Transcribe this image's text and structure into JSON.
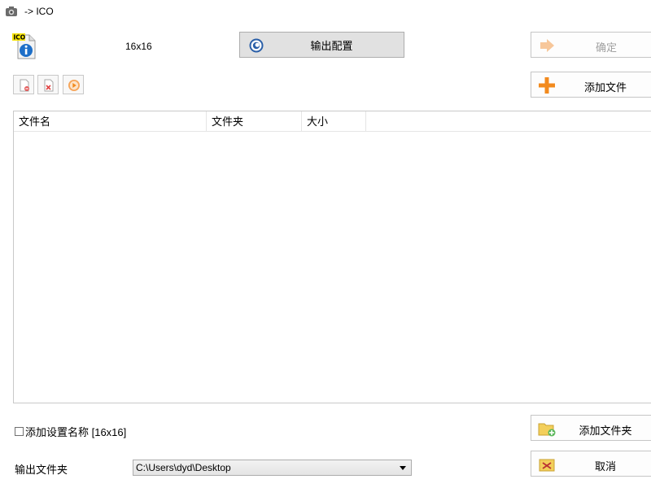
{
  "window": {
    "title": "-> ICO"
  },
  "top": {
    "size_label": "16x16",
    "config_button": "输出配置"
  },
  "actions": {
    "confirm": "确定",
    "add_file": "添加文件",
    "add_folder": "添加文件夹",
    "cancel": "取消"
  },
  "list": {
    "columns": [
      "文件名",
      "文件夹",
      "大小"
    ],
    "rows": []
  },
  "options": {
    "add_setting_name": "添加设置名称 [16x16]",
    "checked": false
  },
  "output": {
    "label": "输出文件夹",
    "path": "C:\\Users\\dyd\\Desktop"
  },
  "colors": {
    "accent_orange": "#f28a1e",
    "disabled_text": "#a0a0a0",
    "border": "#c9c9c9"
  }
}
